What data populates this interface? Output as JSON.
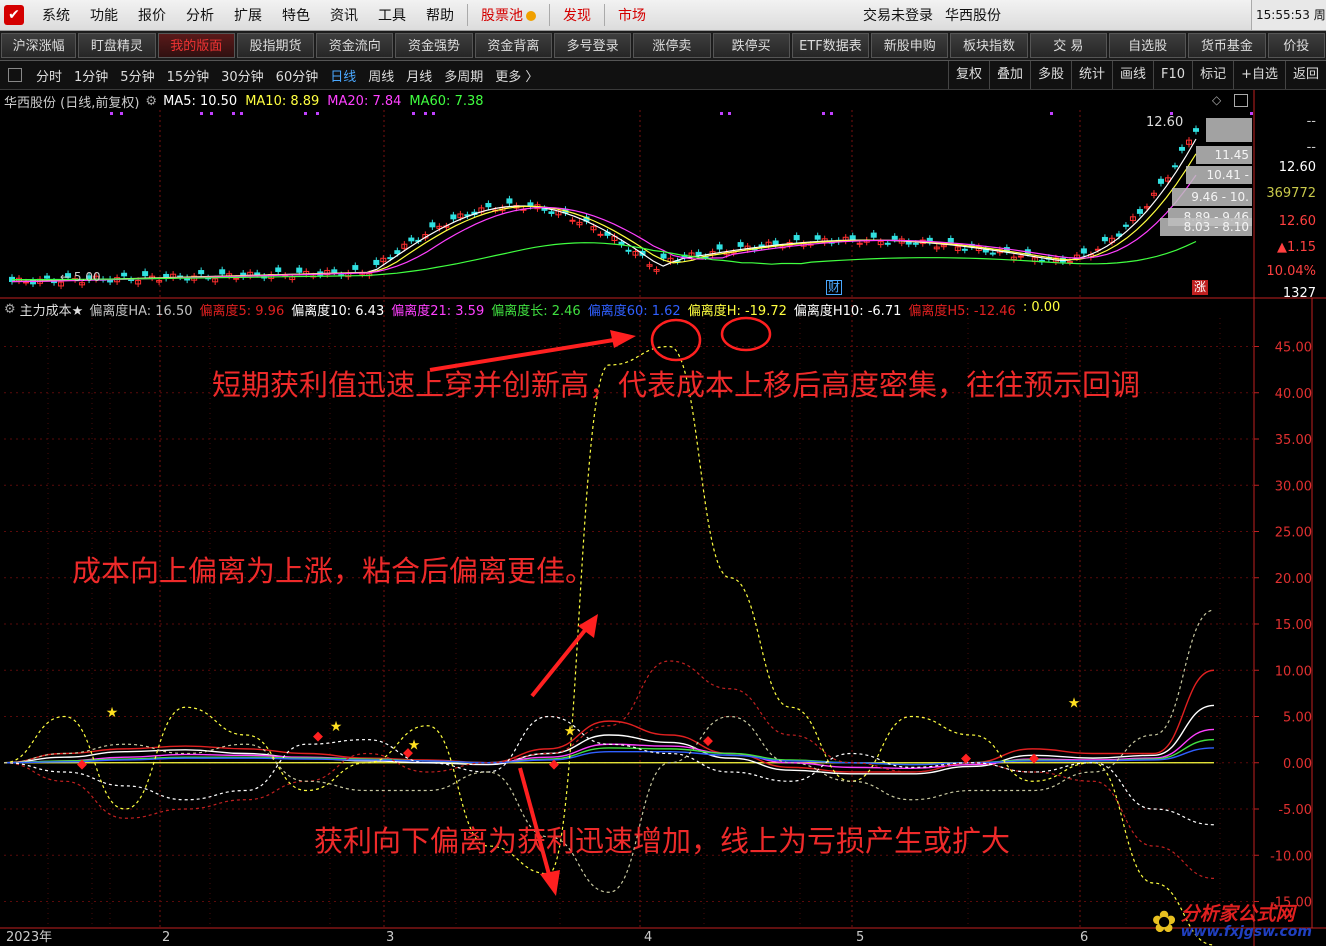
{
  "menu": {
    "items": [
      "系统",
      "功能",
      "报价",
      "分析",
      "扩展",
      "特色",
      "资讯",
      "工具",
      "帮助"
    ],
    "highlight_items": [
      "股票池",
      "发现",
      "市场"
    ],
    "login_status": "交易未登录",
    "broker": "华西股份",
    "clock": "15:55:53 周"
  },
  "toolbar": {
    "buttons": [
      "沪深涨幅",
      "盯盘精灵",
      "我的版面",
      "股指期货",
      "资金流向",
      "资金强势",
      "资金背离",
      "多号登录",
      "涨停卖",
      "跌停买",
      "ETF数据表",
      "新股申购",
      "板块指数",
      "交 易",
      "自选股",
      "货币基金",
      "价投"
    ],
    "active": "我的版面"
  },
  "periods": {
    "items": [
      "分时",
      "1分钟",
      "5分钟",
      "15分钟",
      "30分钟",
      "60分钟",
      "日线",
      "周线",
      "月线",
      "多周期",
      "更多 〉"
    ],
    "active": "日线",
    "right_buttons": [
      "复权",
      "叠加",
      "多股",
      "统计",
      "画线",
      "F10",
      "标记",
      "+自选",
      "返回"
    ]
  },
  "price_panel": {
    "title": "华西股份 (日线,前复权)",
    "ma": [
      {
        "label": "MA5: 10.50",
        "color": "#ffffff"
      },
      {
        "label": "MA10: 8.89",
        "color": "#ffff40"
      },
      {
        "label": "MA20: 7.84",
        "color": "#ff40ff"
      },
      {
        "label": "MA60: 7.38",
        "color": "#40ff40"
      }
    ],
    "low_marker": "← 5.00",
    "high_marker": "12.60",
    "badges": {
      "cai": "财",
      "zhang": "涨"
    },
    "chips": [
      "11.45",
      "10.41 -",
      "9.46 - 10.",
      "8.89 - 9.46",
      "8.03 - 8.10"
    ],
    "side": [
      {
        "text": "--",
        "color": "#cccccc"
      },
      {
        "text": "--",
        "color": "#cccccc"
      },
      {
        "text": "12.60",
        "color": "#ffffff"
      },
      {
        "text": "369772",
        "color": "#c8c84a"
      },
      {
        "text": "12.60",
        "color": "#ff4040"
      },
      {
        "text": "▲1.15",
        "color": "#ff4040"
      },
      {
        "text": "10.04%",
        "color": "#ff4040"
      },
      {
        "text": "1327",
        "color": "#ffffff"
      }
    ]
  },
  "indicator": {
    "title": "主力成本★",
    "items": [
      {
        "label": "偏离度HA: 16.50",
        "color": "#c0c0c0"
      },
      {
        "label": "偏离度5: 9.96",
        "color": "#e02020"
      },
      {
        "label": "偏离度10: 6.43",
        "color": "#ffffff"
      },
      {
        "label": "偏离度21: 3.59",
        "color": "#ff40ff"
      },
      {
        "label": "偏离度长: 2.46",
        "color": "#40e040"
      },
      {
        "label": "偏离度60: 1.62",
        "color": "#3060ff"
      },
      {
        "label": "偏离度H: -19.72",
        "color": "#ffff40"
      },
      {
        "label": "偏离度H10: -6.71",
        "color": "#ffffff"
      },
      {
        "label": "偏离度H5: -12.46",
        "color": "#e02020"
      },
      {
        "label": ": 0.00",
        "color": "#ffff40"
      }
    ]
  },
  "annotations": [
    "短期获利值迅速上穿并创新高，代表成本上移后高度密集，往往预示回调",
    "成本向上偏离为上涨，粘合后偏离更佳。",
    "获利向下偏离为获利迅速增加，线上为亏损产生或扩大"
  ],
  "xaxis": [
    "2023年",
    "2",
    "3",
    "4",
    "5",
    "6"
  ],
  "watermark": {
    "name": "分析家公式网",
    "url": "www.fxjgsw.com"
  },
  "chart_data": {
    "type": "line",
    "yticks": [
      45,
      40,
      35,
      30,
      25,
      20,
      15,
      10,
      5,
      0,
      -5,
      -10,
      -15
    ],
    "ylim": [
      -17,
      47
    ],
    "x": [
      0,
      5,
      10,
      15,
      20,
      25,
      30,
      35,
      40,
      45,
      50,
      55,
      60,
      65,
      70,
      75,
      80,
      85,
      90,
      95,
      100
    ],
    "series": [
      {
        "name": "偏离度5",
        "color": "#e02020",
        "dash": false,
        "values": [
          0,
          1,
          1.5,
          1.8,
          1.5,
          1,
          0.5,
          0.3,
          0,
          1.5,
          4.5,
          3,
          1,
          -0.5,
          -1,
          -1,
          0,
          1.5,
          1,
          1,
          10
        ]
      },
      {
        "name": "偏离度10",
        "color": "#ffffff",
        "dash": false,
        "values": [
          0,
          0.6,
          1.2,
          1.4,
          1,
          0.5,
          0.2,
          0,
          -0.2,
          1,
          3,
          2.2,
          0.5,
          -0.8,
          -1.2,
          -1.2,
          -0.4,
          0.8,
          0.5,
          0.8,
          6.2
        ]
      },
      {
        "name": "偏离度21",
        "color": "#ff40ff",
        "dash": false,
        "values": [
          0,
          0.2,
          0.6,
          0.9,
          0.8,
          0.6,
          0.4,
          0.2,
          0,
          0.6,
          2,
          1.8,
          1,
          0,
          -0.5,
          -0.6,
          -0.2,
          0.4,
          0.3,
          0.5,
          3.6
        ]
      },
      {
        "name": "偏离度长",
        "color": "#40e040",
        "dash": false,
        "values": [
          0,
          0.2,
          0.4,
          0.6,
          0.6,
          0.5,
          0.4,
          0.2,
          0,
          0.4,
          1.6,
          1.5,
          1,
          0.3,
          0,
          -0.2,
          0,
          0.3,
          0.2,
          0.4,
          2.5
        ]
      },
      {
        "name": "偏离度60",
        "color": "#3060ff",
        "dash": false,
        "values": [
          0,
          0.1,
          0.3,
          0.5,
          0.5,
          0.4,
          0.3,
          0.2,
          0,
          0.3,
          1.2,
          1.2,
          0.8,
          0.2,
          0,
          -0.2,
          0,
          0.2,
          0.2,
          0.3,
          1.6
        ]
      },
      {
        "name": "偏离度H5",
        "color": "#c02020",
        "dash": true,
        "values": [
          0,
          -2,
          -6,
          -5,
          -4,
          -2,
          1,
          -1,
          0,
          1,
          4,
          11,
          8,
          3,
          0,
          -1,
          0,
          -1,
          -2,
          -9,
          -12.5
        ]
      },
      {
        "name": "偏离度H10",
        "color": "#ffffff",
        "dash": true,
        "values": [
          0,
          -1,
          -2.5,
          -4,
          -3,
          2,
          2.5,
          0,
          -1,
          5,
          2,
          1,
          -1,
          -2,
          1,
          -0.5,
          0,
          -1,
          0,
          -5,
          -6.7
        ]
      },
      {
        "name": "偏离度H",
        "color": "#ffff40",
        "dash": true,
        "values": [
          0,
          5,
          -5,
          6,
          3,
          -3,
          0,
          4,
          -9,
          -12,
          43,
          45,
          20,
          6,
          -2,
          5,
          3,
          -2,
          0,
          -13,
          -19.7
        ]
      },
      {
        "name": "偏离度HA",
        "color": "#c8c8a0",
        "dash": true,
        "values": [
          0,
          1,
          2,
          1,
          2,
          -2,
          -3,
          -3,
          -1,
          -8,
          -14,
          0,
          5,
          0,
          -2,
          -4,
          -3,
          -3,
          -1,
          3,
          16.5
        ]
      }
    ],
    "zero_line": {
      "name": "",
      "value": 0,
      "color": "#ffff40"
    }
  }
}
